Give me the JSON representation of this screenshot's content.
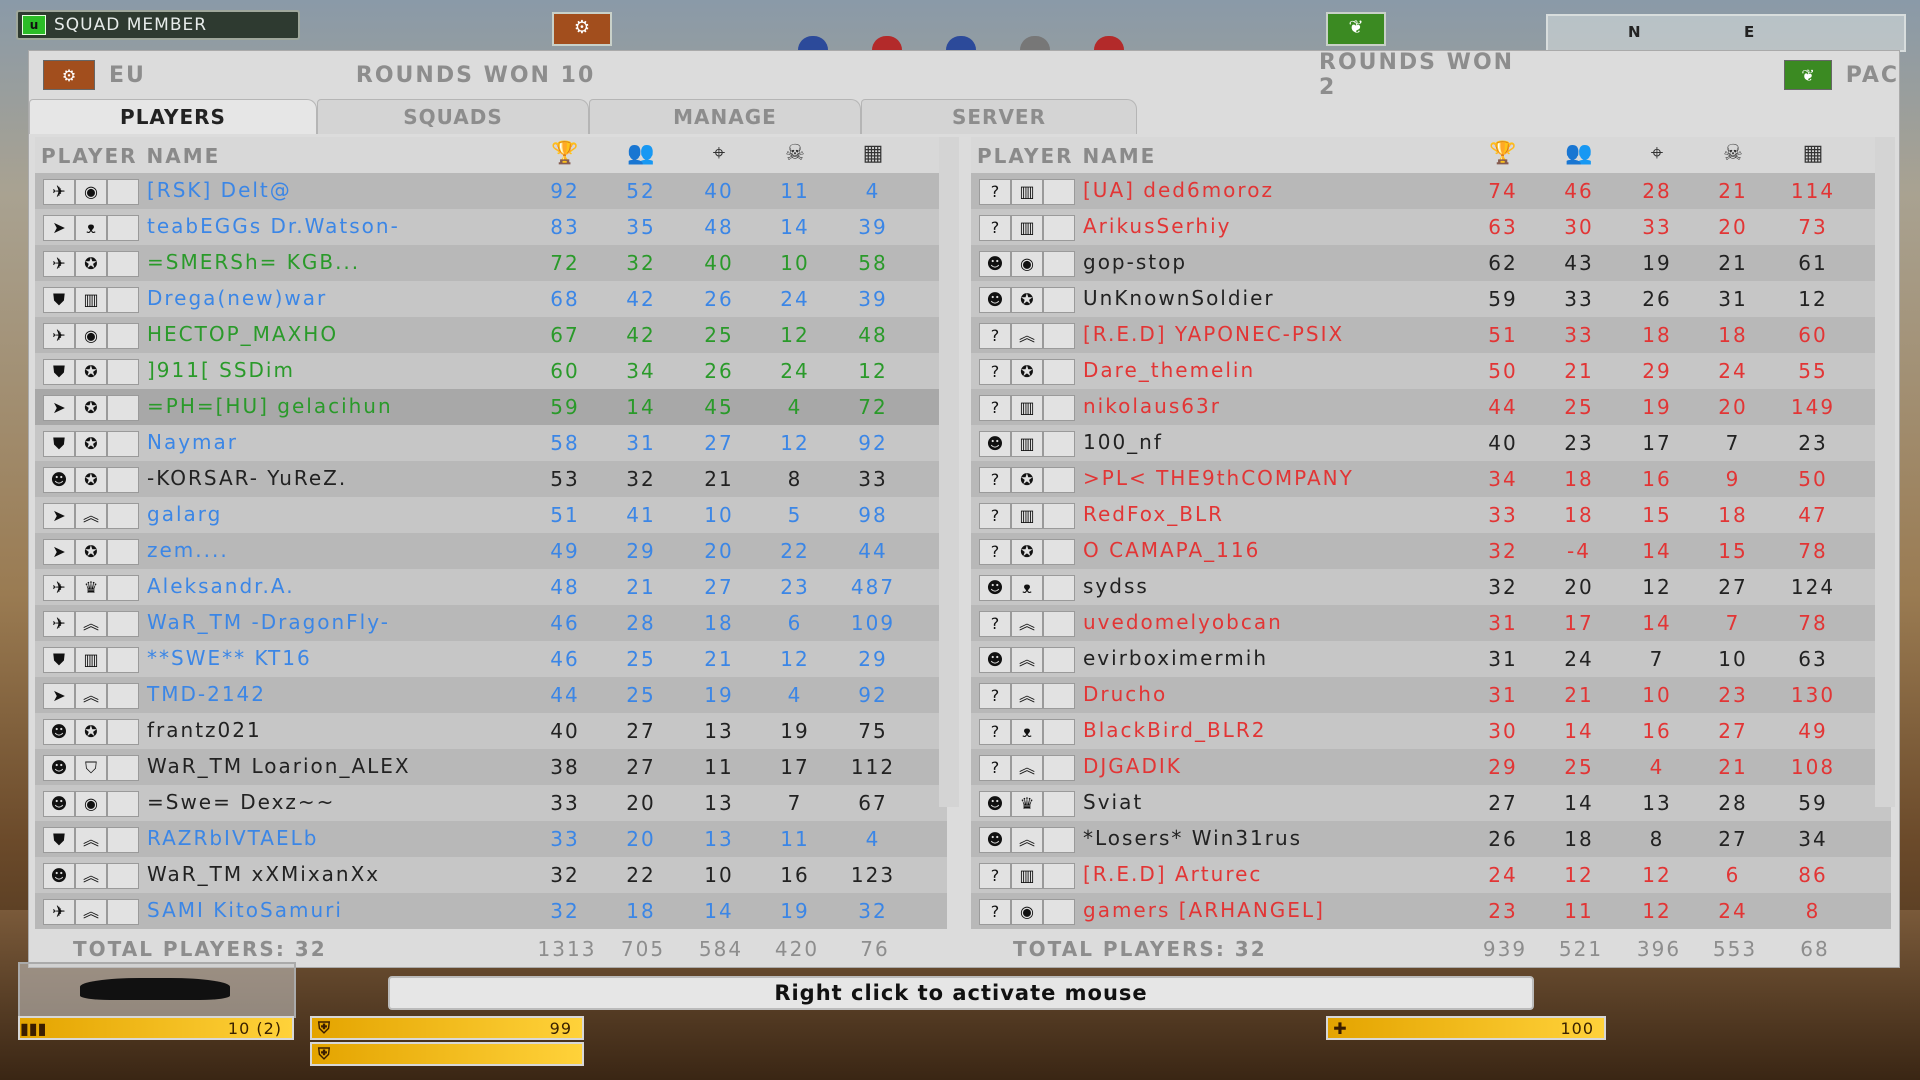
{
  "hud": {
    "squad_label": "SQUAD MEMBER",
    "compass": [
      "N",
      "E"
    ],
    "message": "Right click to activate mouse",
    "ammo": "10 (2)",
    "armor_1": "99",
    "health": "100"
  },
  "teams": {
    "left": {
      "name": "EU",
      "rounds_won": "ROUNDS WON 10"
    },
    "right": {
      "name": "PAC",
      "rounds_won": "ROUNDS WON 2"
    }
  },
  "tabs": [
    "PLAYERS",
    "SQUADS",
    "MANAGE",
    "SERVER"
  ],
  "columns": {
    "player_name": "PLAYER NAME"
  },
  "left_players": [
    {
      "name": "[RSK] Delt@",
      "c": "blue",
      "v": [
        "92",
        "52",
        "40",
        "11",
        "4"
      ],
      "k": "jet",
      "r": "eye"
    },
    {
      "name": "teabEGGs Dr.Watson-",
      "c": "blue",
      "v": [
        "83",
        "35",
        "48",
        "14",
        "39"
      ],
      "k": "heli",
      "r": "wing"
    },
    {
      "name": "=SMERSh= KGB...",
      "c": "green",
      "v": [
        "72",
        "32",
        "40",
        "10",
        "58"
      ],
      "k": "jet",
      "r": "star"
    },
    {
      "name": "Drega(new)war",
      "c": "blue",
      "v": [
        "68",
        "42",
        "26",
        "24",
        "39"
      ],
      "k": "shield",
      "r": "bar"
    },
    {
      "name": "HECTOP_MAXHO",
      "c": "green",
      "v": [
        "67",
        "42",
        "25",
        "12",
        "48"
      ],
      "k": "jet",
      "r": "eye"
    },
    {
      "name": "]911[ SSDim",
      "c": "green",
      "v": [
        "60",
        "34",
        "26",
        "24",
        "12"
      ],
      "k": "shield",
      "r": "star"
    },
    {
      "name": "=PH=[HU] gelacihun",
      "c": "green",
      "v": [
        "59",
        "14",
        "45",
        "4",
        "72"
      ],
      "k": "heli",
      "r": "star"
    },
    {
      "name": "Naymar",
      "c": "blue",
      "v": [
        "58",
        "31",
        "27",
        "12",
        "92"
      ],
      "k": "shield",
      "r": "star"
    },
    {
      "name": "-KORSAR- YuReZ.",
      "c": "dark",
      "v": [
        "53",
        "32",
        "21",
        "8",
        "33"
      ],
      "k": "mask",
      "r": "star"
    },
    {
      "name": "galarg",
      "c": "blue",
      "v": [
        "51",
        "41",
        "10",
        "5",
        "98"
      ],
      "k": "heli",
      "r": "chev"
    },
    {
      "name": "zem....",
      "c": "blue",
      "v": [
        "49",
        "29",
        "20",
        "22",
        "44"
      ],
      "k": "heli",
      "r": "star"
    },
    {
      "name": "Aleksandr.A.",
      "c": "blue",
      "v": [
        "48",
        "21",
        "27",
        "23",
        "487"
      ],
      "k": "jet",
      "r": "medal"
    },
    {
      "name": "WaR_TM -DragonFly-",
      "c": "blue",
      "v": [
        "46",
        "28",
        "18",
        "6",
        "109"
      ],
      "k": "jet",
      "r": "chev"
    },
    {
      "name": "**SWE** KT16",
      "c": "blue",
      "v": [
        "46",
        "25",
        "21",
        "12",
        "29"
      ],
      "k": "shield",
      "r": "bar"
    },
    {
      "name": "TMD-2142",
      "c": "blue",
      "v": [
        "44",
        "25",
        "19",
        "4",
        "92"
      ],
      "k": "heli",
      "r": "chev"
    },
    {
      "name": "frantz021",
      "c": "dark",
      "v": [
        "40",
        "27",
        "13",
        "19",
        "75"
      ],
      "k": "mask",
      "r": "star"
    },
    {
      "name": "WaR_TM Loarion_ALEX",
      "c": "dark",
      "v": [
        "38",
        "27",
        "11",
        "17",
        "112"
      ],
      "k": "mask",
      "r": "badge"
    },
    {
      "name": "=Swe= Dexz~~",
      "c": "dark",
      "v": [
        "33",
        "20",
        "13",
        "7",
        "67"
      ],
      "k": "mask",
      "r": "eye"
    },
    {
      "name": "RAZRbIVTAELb",
      "c": "blue",
      "v": [
        "33",
        "20",
        "13",
        "11",
        "4"
      ],
      "k": "shield",
      "r": "chev"
    },
    {
      "name": "WaR_TM xXMixanXx",
      "c": "dark",
      "v": [
        "32",
        "22",
        "10",
        "16",
        "123"
      ],
      "k": "mask",
      "r": "chev"
    },
    {
      "name": "SAMI KitoSamuri",
      "c": "blue",
      "v": [
        "32",
        "18",
        "14",
        "19",
        "32"
      ],
      "k": "jet",
      "r": "chev"
    }
  ],
  "right_players": [
    {
      "name": "[UA] ded6moroz",
      "c": "red",
      "v": [
        "74",
        "46",
        "28",
        "21",
        "114"
      ],
      "k": "?",
      "r": "bar"
    },
    {
      "name": "ArikusSerhiy",
      "c": "red",
      "v": [
        "63",
        "30",
        "33",
        "20",
        "73"
      ],
      "k": "?",
      "r": "bar"
    },
    {
      "name": "gop-stop",
      "c": "dark",
      "v": [
        "62",
        "43",
        "19",
        "21",
        "61"
      ],
      "k": "mask",
      "r": "eye"
    },
    {
      "name": "UnKnownSoldier",
      "c": "dark",
      "v": [
        "59",
        "33",
        "26",
        "31",
        "12"
      ],
      "k": "mask",
      "r": "star"
    },
    {
      "name": "[R.E.D] YAPONEC-PSIX",
      "c": "red",
      "v": [
        "51",
        "33",
        "18",
        "18",
        "60"
      ],
      "k": "?",
      "r": "chev"
    },
    {
      "name": "Dare_themelin",
      "c": "red",
      "v": [
        "50",
        "21",
        "29",
        "24",
        "55"
      ],
      "k": "?",
      "r": "star"
    },
    {
      "name": "nikolaus63r",
      "c": "red",
      "v": [
        "44",
        "25",
        "19",
        "20",
        "149"
      ],
      "k": "?",
      "r": "bar"
    },
    {
      "name": "100_nf",
      "c": "dark",
      "v": [
        "40",
        "23",
        "17",
        "7",
        "23"
      ],
      "k": "mask",
      "r": "bar"
    },
    {
      "name": ">PL< THE9thCOMPANY",
      "c": "red",
      "v": [
        "34",
        "18",
        "16",
        "9",
        "50"
      ],
      "k": "?",
      "r": "star"
    },
    {
      "name": "RedFox_BLR",
      "c": "red",
      "v": [
        "33",
        "18",
        "15",
        "18",
        "47"
      ],
      "k": "?",
      "r": "bar"
    },
    {
      "name": "O CAMAPA_116",
      "c": "red",
      "v": [
        "32",
        "-4",
        "14",
        "15",
        "78"
      ],
      "k": "?",
      "r": "star"
    },
    {
      "name": "sydss",
      "c": "dark",
      "v": [
        "32",
        "20",
        "12",
        "27",
        "124"
      ],
      "k": "mask",
      "r": "wing"
    },
    {
      "name": "uvedomelyobcan",
      "c": "red",
      "v": [
        "31",
        "17",
        "14",
        "7",
        "78"
      ],
      "k": "?",
      "r": "chev"
    },
    {
      "name": "evirboximermih",
      "c": "dark",
      "v": [
        "31",
        "24",
        "7",
        "10",
        "63"
      ],
      "k": "mask",
      "r": "chev"
    },
    {
      "name": "Drucho",
      "c": "red",
      "v": [
        "31",
        "21",
        "10",
        "23",
        "130"
      ],
      "k": "?",
      "r": "chev"
    },
    {
      "name": "BlackBird_BLR2",
      "c": "red",
      "v": [
        "30",
        "14",
        "16",
        "27",
        "49"
      ],
      "k": "?",
      "r": "wing"
    },
    {
      "name": "DJGADIK",
      "c": "red",
      "v": [
        "29",
        "25",
        "4",
        "21",
        "108"
      ],
      "k": "?",
      "r": "chev"
    },
    {
      "name": "Sviat",
      "c": "dark",
      "v": [
        "27",
        "14",
        "13",
        "28",
        "59"
      ],
      "k": "mask",
      "r": "medal"
    },
    {
      "name": "*Losers* Win31rus",
      "c": "dark",
      "v": [
        "26",
        "18",
        "8",
        "27",
        "34"
      ],
      "k": "mask",
      "r": "chev"
    },
    {
      "name": "[R.E.D] Arturec",
      "c": "red",
      "v": [
        "24",
        "12",
        "12",
        "6",
        "86"
      ],
      "k": "?",
      "r": "bar"
    },
    {
      "name": "gamers [ARHANGEL]",
      "c": "red",
      "v": [
        "23",
        "11",
        "12",
        "24",
        "8"
      ],
      "k": "?",
      "r": "eye"
    }
  ],
  "totals": {
    "left": {
      "label": "TOTAL PLAYERS: 32",
      "v": [
        "1313",
        "705",
        "584",
        "420",
        "76"
      ]
    },
    "right": {
      "label": "TOTAL PLAYERS: 32",
      "v": [
        "939",
        "521",
        "396",
        "553",
        "68"
      ]
    }
  },
  "colors": {
    "blue": "#3b86e6",
    "red": "#e23535",
    "green": "#2a9a2a",
    "dark": "#222222"
  }
}
